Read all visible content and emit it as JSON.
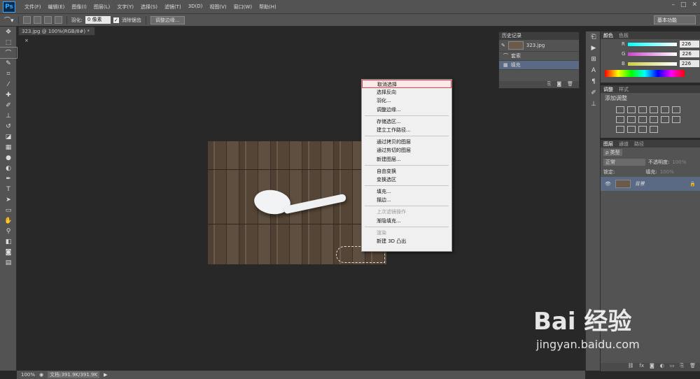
{
  "app": {
    "logo": "Ps"
  },
  "menubar": {
    "items": [
      "文件(F)",
      "编辑(E)",
      "图像(I)",
      "图层(L)",
      "文字(Y)",
      "选择(S)",
      "滤镜(T)",
      "3D(D)",
      "视图(V)",
      "窗口(W)",
      "帮助(H)"
    ]
  },
  "options": {
    "feather_label": "羽化:",
    "feather_value": "0 像素",
    "antialias_label": "消除锯齿",
    "refine_edge": "调整边缘...",
    "workspace": "基本功能"
  },
  "document": {
    "tab_title": "323.jpg @ 100%(RGB/8#) *",
    "close": "×"
  },
  "context_menu": {
    "groups": [
      [
        "取消选择",
        "选择反向",
        "羽化...",
        "调整边缘..."
      ],
      [
        "存储选区...",
        "建立工作路径..."
      ],
      [
        "通过拷贝的图层",
        "通过剪切的图层",
        "新建图层..."
      ],
      [
        "自由变换",
        "变换选区"
      ],
      [
        "填充...",
        "描边..."
      ],
      [
        "上次滤镜操作",
        "渐隐填充..."
      ],
      [
        "渲染",
        "新建 3D 凸出"
      ]
    ],
    "highlighted": "取消选择",
    "disabled": [
      "上次滤镜操作",
      "渲染"
    ]
  },
  "history": {
    "title": "历史记录",
    "snapshot": "323.jpg",
    "steps": [
      "套索",
      "填充"
    ],
    "selected": "填充"
  },
  "color_panel": {
    "tabs": [
      "颜色",
      "色板"
    ],
    "channels": [
      {
        "label": "R",
        "value": "226",
        "color": "#e04a4a"
      },
      {
        "label": "G",
        "value": "226",
        "color": "#c04ac0"
      },
      {
        "label": "B",
        "value": "226",
        "color": "#d8c83a"
      }
    ]
  },
  "adjustments": {
    "tabs": [
      "调整",
      "样式"
    ],
    "title": "添加调整"
  },
  "layers": {
    "tabs": [
      "图层",
      "通道",
      "路径"
    ],
    "kind": "ρ 类型",
    "blend": "正常",
    "opacity_label": "不透明度:",
    "opacity": "100%",
    "lock_label": "锁定:",
    "fill_label": "填充:",
    "fill": "100%",
    "layer_name": "背景"
  },
  "status": {
    "zoom": "100%",
    "doc_info": "文档:391.9K/391.9K"
  },
  "watermark": {
    "brand": "Bai 经验",
    "url": "jingyan.baidu.com"
  }
}
